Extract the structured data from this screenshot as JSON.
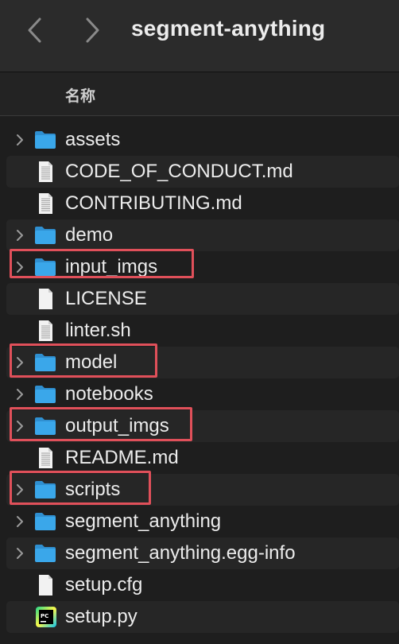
{
  "window": {
    "title": "segment-anything"
  },
  "nav": {
    "back_icon": "chevron-left-icon",
    "forward_icon": "chevron-right-icon"
  },
  "columns": {
    "name_header": "名称"
  },
  "colors": {
    "folder": "#3aa7ea",
    "highlight": "#e0505a",
    "background": "#1e1e1e"
  },
  "files": [
    {
      "name": "assets",
      "kind": "folder",
      "expandable": true,
      "highlighted": false
    },
    {
      "name": "CODE_OF_CONDUCT.md",
      "kind": "text-file",
      "expandable": false,
      "highlighted": false
    },
    {
      "name": "CONTRIBUTING.md",
      "kind": "text-file",
      "expandable": false,
      "highlighted": false
    },
    {
      "name": "demo",
      "kind": "folder",
      "expandable": true,
      "highlighted": false
    },
    {
      "name": "input_imgs",
      "kind": "folder",
      "expandable": true,
      "highlighted": true
    },
    {
      "name": "LICENSE",
      "kind": "blank-file",
      "expandable": false,
      "highlighted": false
    },
    {
      "name": "linter.sh",
      "kind": "text-file",
      "expandable": false,
      "highlighted": false
    },
    {
      "name": "model",
      "kind": "folder",
      "expandable": true,
      "highlighted": true
    },
    {
      "name": "notebooks",
      "kind": "folder",
      "expandable": true,
      "highlighted": false
    },
    {
      "name": "output_imgs",
      "kind": "folder",
      "expandable": true,
      "highlighted": true
    },
    {
      "name": "README.md",
      "kind": "text-file",
      "expandable": false,
      "highlighted": false
    },
    {
      "name": "scripts",
      "kind": "folder",
      "expandable": true,
      "highlighted": true
    },
    {
      "name": "segment_anything",
      "kind": "folder",
      "expandable": true,
      "highlighted": false
    },
    {
      "name": "segment_anything.egg-info",
      "kind": "folder",
      "expandable": true,
      "highlighted": false
    },
    {
      "name": "setup.cfg",
      "kind": "blank-file",
      "expandable": false,
      "highlighted": false
    },
    {
      "name": "setup.py",
      "kind": "pycharm-file",
      "expandable": false,
      "highlighted": false
    }
  ]
}
